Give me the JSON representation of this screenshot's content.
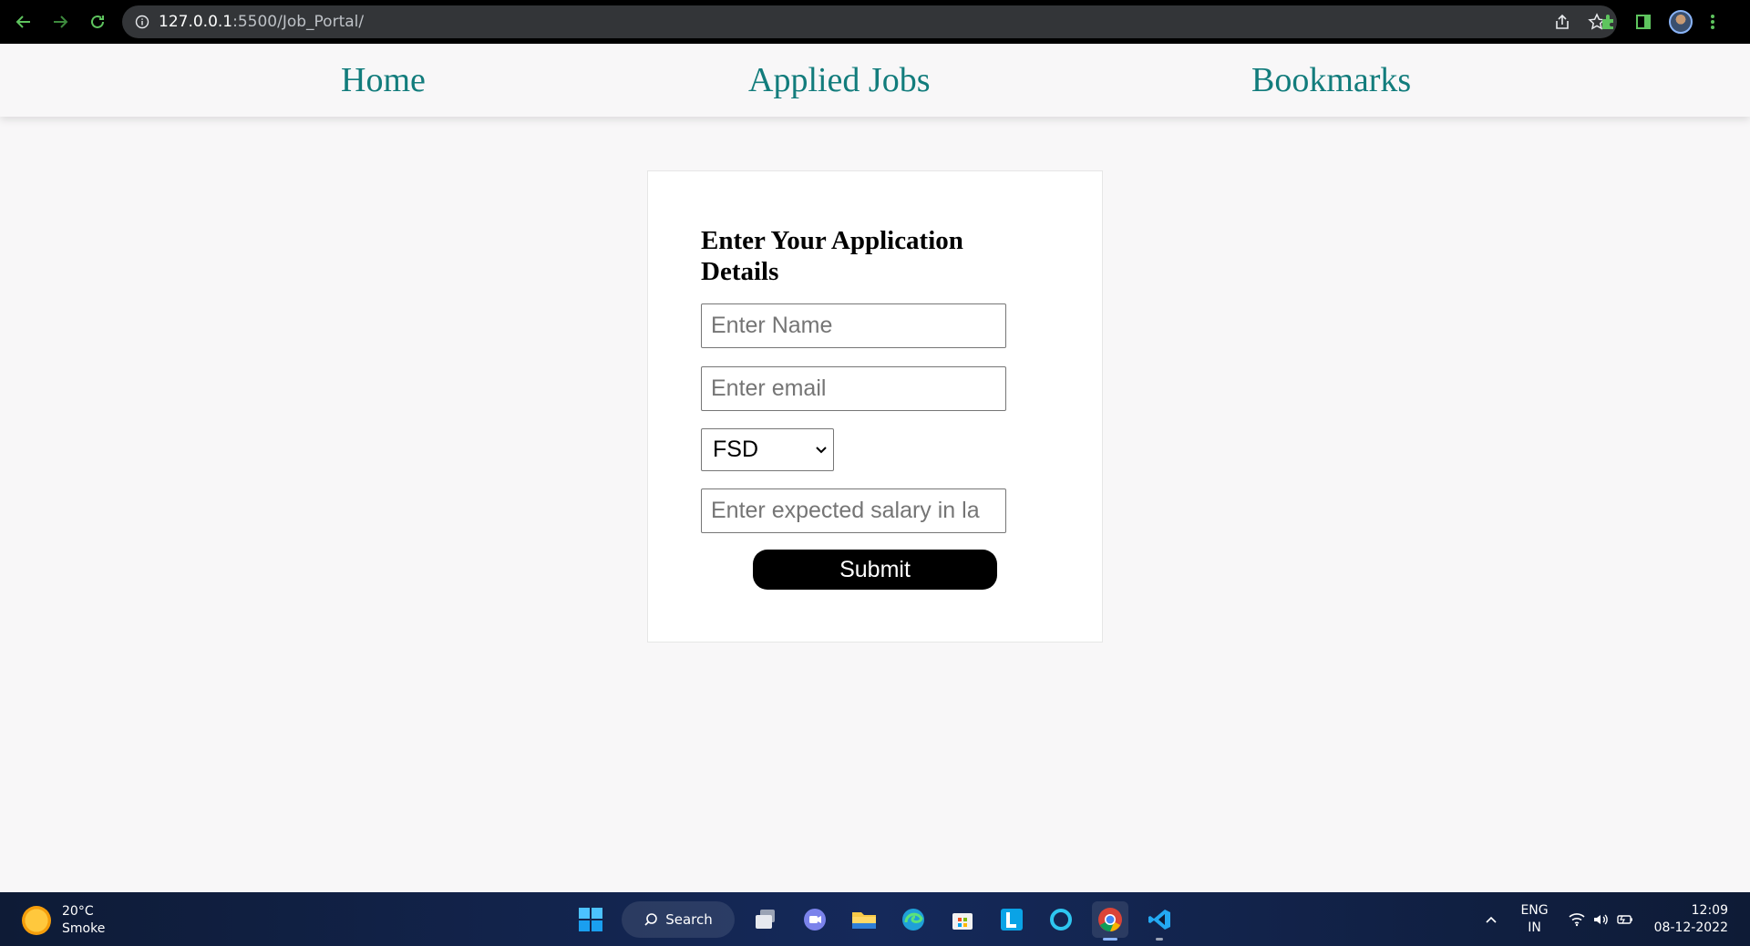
{
  "browser": {
    "url_host": "127.0.0.1",
    "url_path": ":5500/Job_Portal/"
  },
  "nav": {
    "home": "Home",
    "applied_jobs": "Applied Jobs",
    "bookmarks": "Bookmarks"
  },
  "form": {
    "title": "Enter Your Application Details",
    "name_placeholder": "Enter Name",
    "email_placeholder": "Enter email",
    "role_selected": "FSD",
    "salary_placeholder": "Enter expected salary in la",
    "submit_label": "Submit"
  },
  "taskbar": {
    "weather_temp": "20°C",
    "weather_desc": "Smoke",
    "search_label": "Search",
    "lang_line1": "ENG",
    "lang_line2": "IN",
    "time": "12:09",
    "date": "08-12-2022"
  },
  "colors": {
    "nav_link": "#127c7c",
    "page_bg": "#f8f7f8",
    "submit_bg": "#000000"
  }
}
